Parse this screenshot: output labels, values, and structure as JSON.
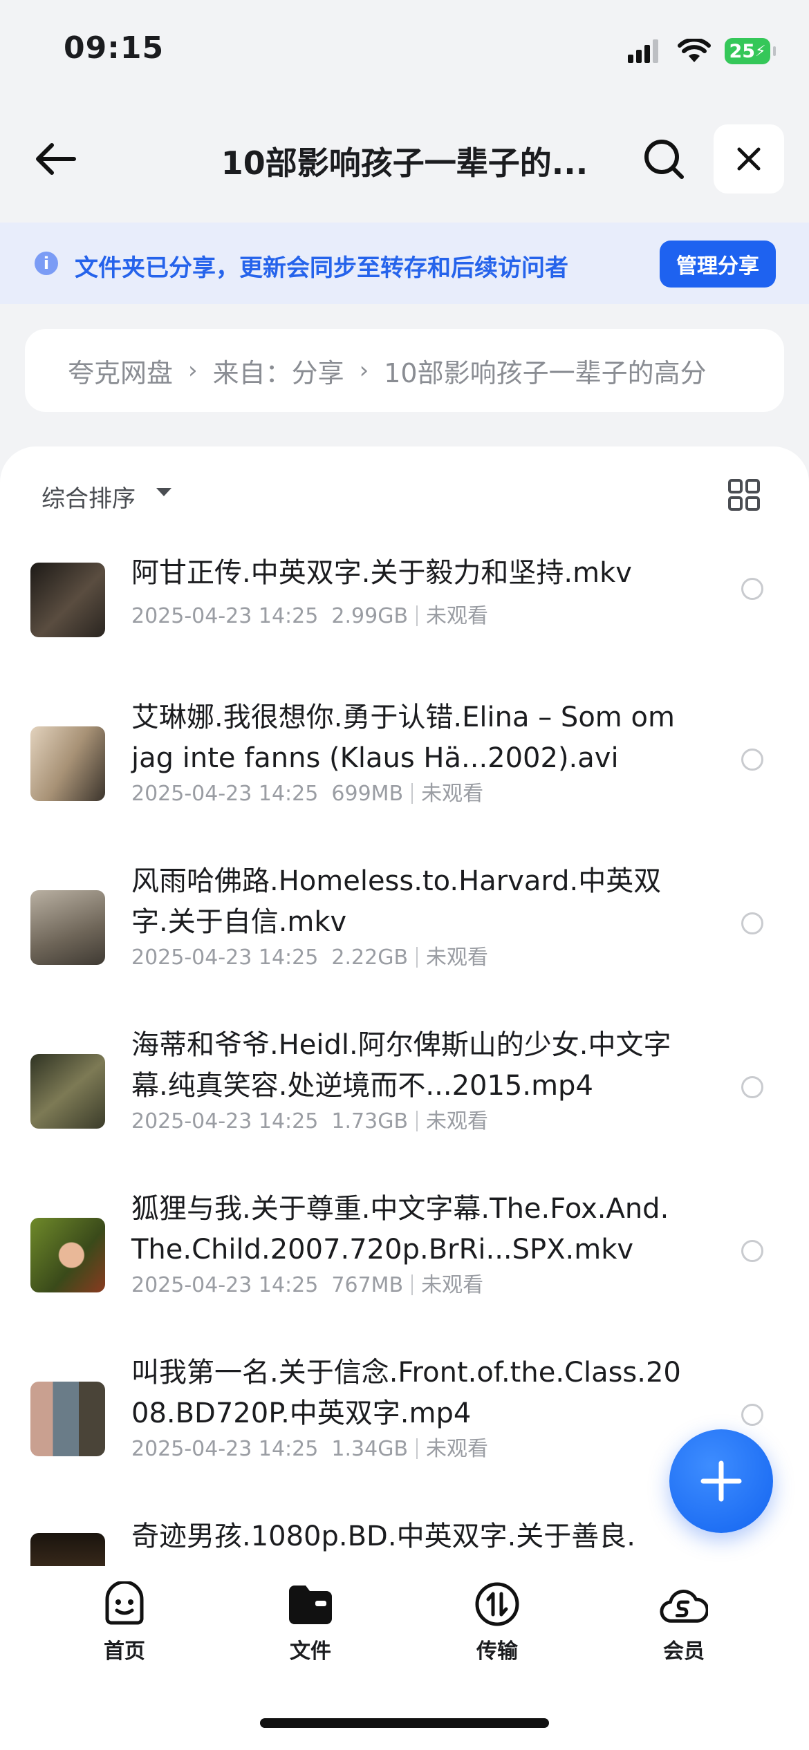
{
  "status": {
    "time": "09:15",
    "battery": "25",
    "signal_icon": "cellular-signal-icon",
    "wifi_icon": "wifi-icon"
  },
  "header": {
    "title": "10部影响孩子一辈子的...",
    "back_icon": "arrow-left-icon",
    "search_icon": "search-icon",
    "close_icon": "close-icon"
  },
  "notice": {
    "text": "文件夹已分享，更新会同步至转存和后续访问者",
    "button": "管理分享",
    "icon": "info-icon"
  },
  "breadcrumb": {
    "items": [
      "夸克网盘",
      "来自：分享",
      "10部影响孩子一辈子的高分"
    ],
    "separator": "›"
  },
  "sort": {
    "label": "综合排序",
    "view_icon": "grid-view-icon"
  },
  "files": [
    {
      "name": "阿甘正传.中英双字.关于毅力和坚持.mkv",
      "date": "2025-04-23 14:25",
      "size": "2.99GB",
      "status": "未观看",
      "thumb_color": "#3a3530"
    },
    {
      "name": "艾琳娜.我很想你.勇于认错.Elina – Som om jag inte fanns (Klaus Hä...2002).avi",
      "date": "2025-04-23 14:25",
      "size": "699MB",
      "status": "未观看",
      "thumb_color": "#c9b7a0"
    },
    {
      "name": "风雨哈佛路.Homeless.to.Harvard.中英双字.关于自信.mkv",
      "date": "2025-04-23 14:25",
      "size": "2.22GB",
      "status": "未观看",
      "thumb_color": "#8c8577"
    },
    {
      "name": "海蒂和爷爷.Heidl.阿尔俾斯山的少女.中文字幕.纯真笑容.处逆境而不...2015.mp4",
      "date": "2025-04-23 14:25",
      "size": "1.73GB",
      "status": "未观看",
      "thumb_color": "#4d5038"
    },
    {
      "name": "狐狸与我.关于尊重.中文字幕.The.Fox.And.The.Child.2007.720p.BrRi...SPX.mkv",
      "date": "2025-04-23 14:25",
      "size": "767MB",
      "status": "未观看",
      "thumb_color": "#5d6a2c"
    },
    {
      "name": "叫我第一名.关于信念.Front.of.the.Class.2008.BD720P.中英双字.mp4",
      "date": "2025-04-23 14:25",
      "size": "1.34GB",
      "status": "未观看",
      "thumb_color": "#7a6a5a"
    },
    {
      "name": "奇迹男孩.1080p.BD.中英双字.关于善良.",
      "date": "",
      "size": "",
      "status": "",
      "thumb_color": "#2a2218"
    }
  ],
  "fab": {
    "icon": "plus-icon"
  },
  "tabs": [
    {
      "label": "首页",
      "icon": "smiley-home-icon"
    },
    {
      "label": "文件",
      "icon": "folder-icon"
    },
    {
      "label": "传输",
      "icon": "transfer-icon"
    },
    {
      "label": "会员",
      "icon": "vip-cloud-icon"
    }
  ]
}
